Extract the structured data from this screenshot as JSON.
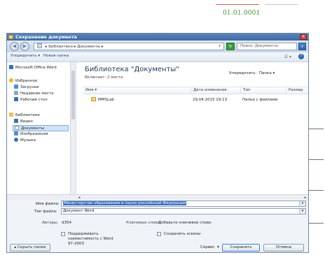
{
  "document": {
    "code": "01.01.0001"
  },
  "window": {
    "title": "Сохранение документа",
    "close_glyph": "✕"
  },
  "nav": {
    "back_glyph": "◀",
    "forward_glyph": "▶",
    "breadcrumb": [
      "Библиотеки",
      "Документы"
    ],
    "breadcrumb_sep": "▸",
    "address_dropdown_glyph": "▾",
    "refresh_glyph": "↻",
    "search_placeholder": "Поиск: Документы",
    "search_icon": "search-icon",
    "search_glyph": "⌕"
  },
  "toolbar": {
    "organize_label": "Упорядочить ▾",
    "new_folder_label": "Новая папка",
    "view_glyph": "☰ ▾",
    "help_glyph": "?"
  },
  "sidebar": {
    "items": [
      {
        "label": "Microsoft Office Word",
        "icon": "word-icon",
        "color": "#3a6fc0",
        "selected": false
      },
      {
        "label": "Избранное",
        "icon": "star-icon",
        "color": "#f0b928",
        "selected": false
      },
      {
        "label": "Загрузки",
        "icon": "downloads-icon",
        "color": "#4a8fd6",
        "selected": false
      },
      {
        "label": "Недавние места",
        "icon": "recent-places-icon",
        "color": "#8aa7c7",
        "selected": false
      },
      {
        "label": "Рабочий стол",
        "icon": "desktop-icon",
        "color": "#3b6fb6",
        "selected": false
      },
      {
        "label": "Библиотеки",
        "icon": "libraries-icon",
        "color": "#e8c25a",
        "selected": false
      },
      {
        "label": "Видео",
        "icon": "video-icon",
        "color": "#4a6fa0",
        "selected": false
      },
      {
        "label": "Документы",
        "icon": "documents-icon",
        "color": "#d9e3ee",
        "selected": true
      },
      {
        "label": "Изображения",
        "icon": "pictures-icon",
        "color": "#5c8fc4",
        "selected": false
      },
      {
        "label": "Музыка",
        "icon": "music-icon",
        "color": "#3a6fc0",
        "selected": false
      }
    ]
  },
  "main": {
    "library_title": "Библиотека \"Документы\"",
    "includes": "Включает: 2 места",
    "arrange_label": "Упорядочить:",
    "arrange_value": "Папка ▾",
    "columns": [
      "Имя ▾",
      "Дата изменения",
      "Тип",
      "Размер"
    ],
    "rows": [
      {
        "name": "MMSLab",
        "date": "29.04.2015 19:13",
        "type": "Папка с файлами",
        "size": ""
      }
    ]
  },
  "form": {
    "filename_label": "Имя файла:",
    "filename_value": "Министерство образования и науки российской Федерации",
    "filetype_label": "Тип файла:",
    "filetype_value": "Документ Word",
    "authors_label": "Авторы:",
    "authors_value": "d354",
    "keywords_label": "Ключевые слова:",
    "keywords_value": "Добавьте ключевое слово",
    "compat_label_1": "Поддерживать",
    "compat_label_2": "совместимость с Word",
    "compat_label_3": "97-2003",
    "thumbnail_label": "Сохранять эскизы",
    "dropdown_glyph": "▾"
  },
  "footer": {
    "hide_folders_label": "▴ Скрыть папки",
    "service_label": "Сервис",
    "service_glyph": "▾",
    "save_label": "Сохранить",
    "cancel_label": "Отмена"
  },
  "colors": {
    "titlebar": "#3d6aa3",
    "selection": "#3a6fc0",
    "code_text": "#3c9a3c",
    "accent_red": "#d86060"
  }
}
